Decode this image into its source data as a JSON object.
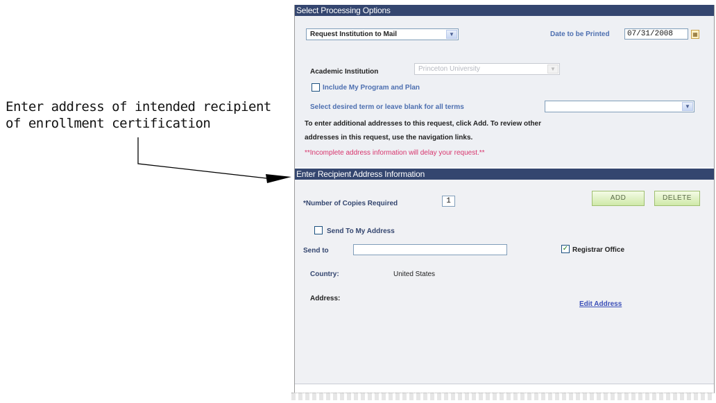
{
  "callout": {
    "line1": "Enter address of intended recipient",
    "line2": "of enrollment certification"
  },
  "processing": {
    "header": "Select Processing Options",
    "request_type": "Request Institution to Mail",
    "date_label": "Date to be Printed",
    "date_value": "07/31/2008",
    "institution_label": "Academic Institution",
    "institution_value": "Princeton University",
    "include_program_label": "Include My Program and Plan",
    "term_label": "Select desired term or leave blank for all terms",
    "term_value": "",
    "info_line1": "To enter additional addresses to this request, click Add. To review other",
    "info_line2": "addresses in this request, use the navigation links.",
    "warning": "**Incomplete address information will delay your request.**"
  },
  "recipient": {
    "header": "Enter Recipient Address Information",
    "copies_label": "*Number of Copies Required",
    "copies_value": "1",
    "add_label": "ADD",
    "delete_label": "DELETE",
    "send_to_my_address_label": "Send To My Address",
    "send_to_label": "Send to",
    "send_to_value": "",
    "registrar_label": "Registrar Office",
    "registrar_checked": true,
    "country_label": "Country:",
    "country_value": "United States",
    "address_label": "Address:",
    "edit_address_label": "Edit Address"
  }
}
